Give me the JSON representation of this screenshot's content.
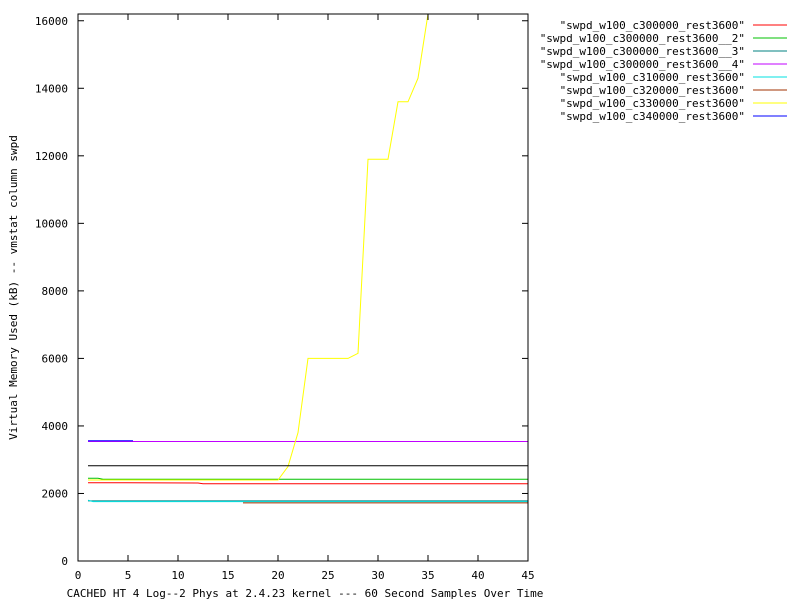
{
  "chart_data": {
    "type": "line",
    "title": "",
    "xlabel": "CACHED HT 4 Log--2 Phys at 2.4.23 kernel --- 60 Second Samples Over Time",
    "ylabel": "Virtual Memory Used (kB) -- vmstat column swpd",
    "xlim": [
      0,
      45
    ],
    "ylim": [
      0,
      16200
    ],
    "xticks": [
      0,
      5,
      10,
      15,
      20,
      25,
      30,
      35,
      40,
      45
    ],
    "yticks": [
      0,
      2000,
      4000,
      6000,
      8000,
      10000,
      12000,
      14000,
      16000
    ],
    "legend_position": "right",
    "series": [
      {
        "name": "\"swpd_w100_c300000_rest3600\"",
        "color": "#ff0000",
        "x": [
          1,
          12,
          12.5,
          45
        ],
        "y": [
          2320,
          2310,
          2290,
          2290
        ]
      },
      {
        "name": "\"swpd_w100_c300000_rest3600__2\"",
        "color": "#00c000",
        "x": [
          1,
          2,
          2.5,
          45
        ],
        "y": [
          2450,
          2450,
          2420,
          2420
        ]
      },
      {
        "name": "\"swpd_w100_c300000_rest3600__3\"",
        "color": "#008080",
        "x": [
          1,
          45
        ],
        "y": [
          1780,
          1780
        ]
      },
      {
        "name": "\"swpd_w100_c300000_rest3600__4\"",
        "color": "#c000ff",
        "x": [
          1,
          45
        ],
        "y": [
          3540,
          3540
        ]
      },
      {
        "name": "\"swpd_w100_c310000_rest3600\"",
        "color": "#00e0e0",
        "x": [
          1,
          1.5,
          45
        ],
        "y": [
          1800,
          1760,
          1760
        ]
      },
      {
        "name": "\"swpd_w100_c320000_rest3600\"",
        "color": "#a03000",
        "x": [
          16.5,
          45
        ],
        "y": [
          1720,
          1720
        ]
      },
      {
        "name": "\"swpd_w100_c330000_rest3600\"",
        "color": "#ffff00",
        "x": [
          1,
          20,
          21,
          22,
          23,
          24,
          26,
          27,
          28,
          29,
          31,
          32,
          33,
          34,
          35,
          45
        ],
        "y": [
          2400,
          2400,
          2800,
          3800,
          6000,
          6000,
          6000,
          6000,
          6150,
          11900,
          11900,
          13600,
          13600,
          14300,
          16200,
          16200
        ]
      },
      {
        "name": "\"swpd_w100_c340000_rest3600\"",
        "color": "#0000ff",
        "x": [
          1,
          5.5
        ],
        "y": [
          3560,
          3560
        ]
      },
      {
        "name": "",
        "color": "#000000",
        "x": [
          1,
          45
        ],
        "y": [
          2820,
          2820
        ]
      }
    ]
  }
}
